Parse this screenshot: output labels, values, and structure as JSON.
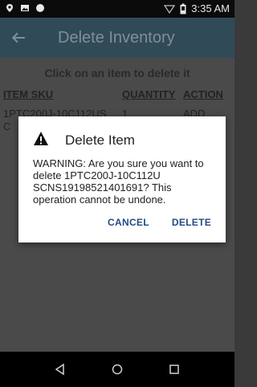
{
  "status_bar": {
    "time": "3:35 AM",
    "icons": [
      "location-icon",
      "image-icon",
      "circle-icon",
      "wifi-icon",
      "battery-icon"
    ]
  },
  "app_bar": {
    "title": "Delete Inventory",
    "back_icon": "arrow-left-icon"
  },
  "content": {
    "hint": "Click on an item to delete it",
    "table": {
      "headers": [
        "ITEM SKU",
        "QUANTITY",
        "ACTION"
      ],
      "rows": [
        {
          "sku": "1PTC200J-10C112US",
          "sku_wrap": "C",
          "quantity": "1",
          "action": "ADD"
        }
      ]
    }
  },
  "dialog": {
    "icon": "warning-icon",
    "title": "Delete Item",
    "message": "WARNING: Are you sure you want to delete 1PTC200J-10C112U SCNS19198521401691? This operation cannot be undone.",
    "cancel_label": "CANCEL",
    "delete_label": "DELETE"
  },
  "nav_bar": {
    "buttons": [
      "back-triangle-icon",
      "home-circle-icon",
      "recents-square-icon"
    ]
  }
}
